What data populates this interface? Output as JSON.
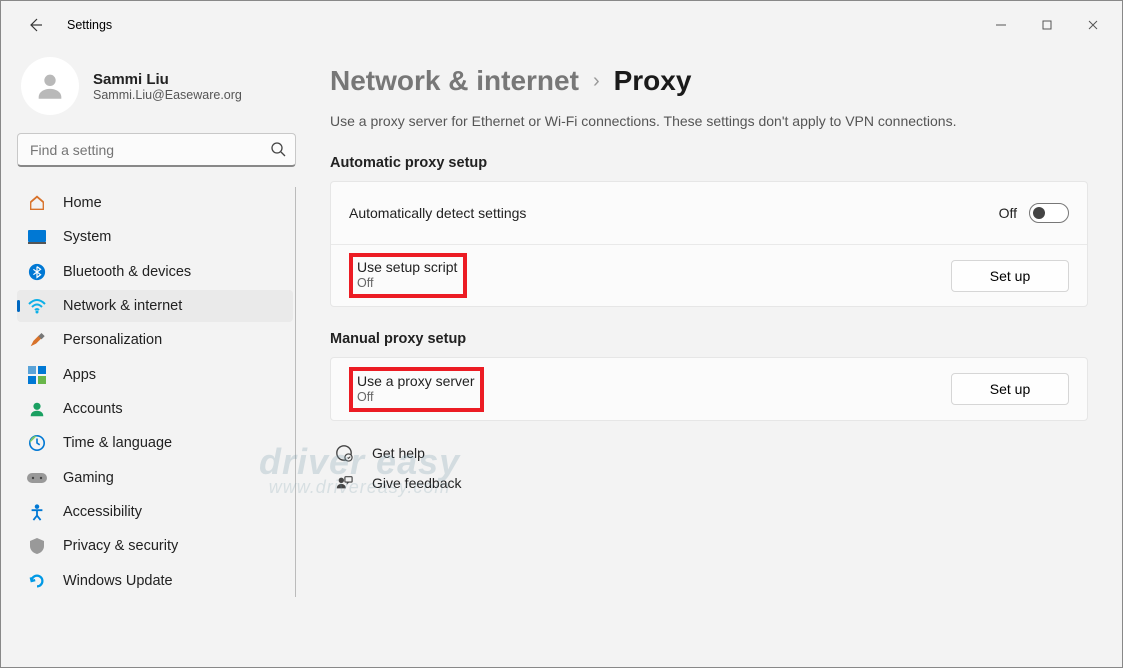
{
  "window": {
    "title": "Settings"
  },
  "user": {
    "name": "Sammi Liu",
    "email": "Sammi.Liu@Easeware.org"
  },
  "search": {
    "placeholder": "Find a setting"
  },
  "nav": {
    "items": [
      {
        "label": "Home"
      },
      {
        "label": "System"
      },
      {
        "label": "Bluetooth & devices"
      },
      {
        "label": "Network & internet"
      },
      {
        "label": "Personalization"
      },
      {
        "label": "Apps"
      },
      {
        "label": "Accounts"
      },
      {
        "label": "Time & language"
      },
      {
        "label": "Gaming"
      },
      {
        "label": "Accessibility"
      },
      {
        "label": "Privacy & security"
      },
      {
        "label": "Windows Update"
      }
    ]
  },
  "breadcrumb": {
    "parent": "Network & internet",
    "current": "Proxy"
  },
  "page": {
    "description": "Use a proxy server for Ethernet or Wi-Fi connections. These settings don't apply to VPN connections."
  },
  "auto": {
    "title": "Automatic proxy setup",
    "detect_label": "Automatically detect settings",
    "detect_state": "Off",
    "script_label": "Use setup script",
    "script_state": "Off",
    "script_button": "Set up"
  },
  "manual": {
    "title": "Manual proxy setup",
    "server_label": "Use a proxy server",
    "server_state": "Off",
    "server_button": "Set up"
  },
  "footer": {
    "help": "Get help",
    "feedback": "Give feedback"
  },
  "watermark": {
    "brand": "driver easy",
    "url": "www.drivereasy.com"
  }
}
